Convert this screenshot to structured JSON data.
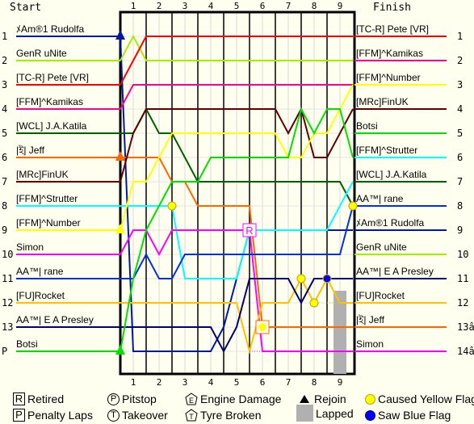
{
  "chart_data": {
    "type": "line",
    "title": "",
    "start_label": "Start",
    "finish_label": "Finish",
    "laps": [
      "1",
      "2",
      "3",
      "4",
      "5",
      "6",
      "7",
      "8",
      "9"
    ],
    "x_axis": "lap (position sampled every half lap, 0 to 9)",
    "y_axis": "race position (1 at top)",
    "start_positions": [
      "1",
      "2",
      "3",
      "4",
      "5",
      "6",
      "7",
      "8",
      "9",
      "10",
      "11",
      "12",
      "13",
      "P"
    ],
    "finish_positions": [
      "1",
      "2",
      "3",
      "4",
      "5",
      "6",
      "7",
      "8",
      "9",
      "10",
      "11",
      "12",
      "13â",
      "14â"
    ],
    "drivers": [
      {
        "name": "ﾒAm®1 Rudolfa",
        "color": "#0018a0",
        "start": 1,
        "finish": 9,
        "positions": [
          1,
          14,
          14,
          14,
          14,
          14,
          14,
          14,
          13,
          11,
          9,
          9,
          9,
          9,
          9,
          9,
          9,
          9,
          9
        ],
        "events": [
          {
            "type": "rejoin",
            "x": 0
          }
        ]
      },
      {
        "name": "GenR uNite",
        "color": "#a0f000",
        "start": 2,
        "finish": 10,
        "positions": [
          2,
          1,
          2,
          2,
          2,
          2,
          2,
          2,
          2,
          2,
          2,
          2,
          2,
          2,
          2,
          2,
          2,
          2,
          2
        ],
        "events": []
      },
      {
        "name": "[TC-R] Pete [VR]",
        "color": "#ff0000",
        "start": 3,
        "finish": 1,
        "positions": [
          3,
          2,
          1,
          1,
          1,
          1,
          1,
          1,
          1,
          1,
          1,
          1,
          1,
          1,
          1,
          1,
          1,
          1,
          1
        ],
        "events": []
      },
      {
        "name": "[FFM]^Kamikas",
        "color": "#ff0090",
        "start": 4,
        "finish": 2,
        "positions": [
          4,
          3,
          3,
          3,
          3,
          3,
          3,
          3,
          3,
          3,
          3,
          3,
          3,
          3,
          3,
          3,
          3,
          3,
          3
        ],
        "events": []
      },
      {
        "name": "[WCL] J.A.Katila",
        "color": "#006000",
        "start": 5,
        "finish": 7,
        "positions": [
          5,
          5,
          4,
          5,
          5,
          6,
          7,
          7,
          7,
          7,
          7,
          7,
          7,
          7,
          7,
          7,
          7,
          7,
          8
        ],
        "events": [
          {
            "type": "yellow",
            "x": 18
          }
        ]
      },
      {
        "name": "|ই| Jeff",
        "color": "#ff6600",
        "start": 6,
        "finish": 13,
        "positions": [
          6,
          6,
          6,
          6,
          7,
          7,
          8,
          8,
          8,
          8,
          8,
          13,
          13,
          13,
          13,
          13,
          13,
          13,
          13
        ],
        "events": [
          {
            "type": "rejoin",
            "x": 0
          },
          {
            "type": "engine",
            "x": 11
          }
        ]
      },
      {
        "name": "[MRc]FinUK",
        "color": "#600000",
        "start": 7,
        "finish": 4,
        "positions": [
          7,
          5,
          4,
          4,
          4,
          4,
          4,
          4,
          4,
          4,
          4,
          4,
          4,
          5,
          4,
          6,
          6,
          5,
          4
        ],
        "events": []
      },
      {
        "name": "[FFM]^Strutter",
        "color": "#00ffff",
        "start": 8,
        "finish": 6,
        "positions": [
          8,
          8,
          8,
          8,
          8,
          11,
          11,
          11,
          11,
          11,
          9,
          9,
          9,
          9,
          9,
          9,
          9,
          8,
          7
        ],
        "events": [
          {
            "type": "yellow",
            "x": 4
          }
        ]
      },
      {
        "name": "[FFM]^Number",
        "color": "#ffff00",
        "start": 9,
        "finish": 3,
        "positions": [
          9,
          7,
          7,
          6,
          5,
          5,
          5,
          5,
          5,
          5,
          5,
          5,
          5,
          6,
          6,
          5,
          5,
          4,
          3
        ],
        "events": [
          {
            "type": "rejoin",
            "x": 0
          }
        ]
      },
      {
        "name": "Simon",
        "color": "#ff00ff",
        "start": 10,
        "finish": 14,
        "positions": [
          10,
          9,
          9,
          10,
          9,
          9,
          9,
          9,
          9,
          9,
          9,
          14,
          14,
          14,
          14,
          14,
          14,
          14,
          14
        ],
        "events": [
          {
            "type": "retired",
            "x": 10
          }
        ]
      },
      {
        "name": "AA™| rane",
        "color": "#0030e0",
        "start": 11,
        "finish": 8,
        "positions": [
          11,
          11,
          10,
          11,
          11,
          10,
          10,
          10,
          10,
          10,
          10,
          10,
          10,
          10,
          10,
          10,
          10,
          10,
          8
        ],
        "events": []
      },
      {
        "name": "[FU]Rocket",
        "color": "#ffc000",
        "start": 12,
        "finish": 12,
        "positions": [
          12,
          12,
          12,
          12,
          12,
          12,
          12,
          12,
          12,
          12,
          14,
          12,
          12,
          12,
          11,
          12,
          11,
          12,
          12
        ],
        "events": [
          {
            "type": "yellow",
            "x": 14
          },
          {
            "type": "yellow",
            "x": 15
          },
          {
            "type": "yellow",
            "x": 16
          },
          {
            "type": "blue",
            "x": 16
          }
        ]
      },
      {
        "name": "AA™| E A Presley",
        "color": "#000070",
        "start": 13,
        "finish": 11,
        "positions": [
          13,
          13,
          13,
          13,
          13,
          13,
          13,
          13,
          14,
          13,
          11,
          11,
          11,
          11,
          12,
          11,
          11,
          11,
          11
        ],
        "events": []
      },
      {
        "name": "Botsi",
        "color": "#00e000",
        "start": 14,
        "finish": 5,
        "positions": [
          14,
          11,
          9,
          8,
          7,
          7,
          7,
          6,
          6,
          6,
          6,
          6,
          6,
          6,
          4,
          5,
          4,
          4,
          6
        ],
        "events": [
          {
            "type": "rejoin",
            "x": 0
          }
        ]
      }
    ],
    "finish_order": [
      "[TC-R] Pete [VR]",
      "[FFM]^Kamikas",
      "[FFM]^Number",
      "[MRc]FinUK",
      "Botsi",
      "[FFM]^Strutter",
      "[WCL] J.A.Katila",
      "AA™| rane",
      "ﾒAm®1 Rudolfa",
      "GenR uNite",
      "AA™| E A Presley",
      "[FU]Rocket",
      "|ই| Jeff",
      "Simon"
    ],
    "lapped": [
      {
        "lap_from": 8.5,
        "lap_to": 9
      }
    ],
    "legend": [
      {
        "icon": "R",
        "label": "Retired"
      },
      {
        "icon": "P-circle",
        "label": "Pitstop"
      },
      {
        "icon": "E-pentagon",
        "label": "Engine Damage"
      },
      {
        "icon": "triangle",
        "label": "Rejoin"
      },
      {
        "icon": "yellow-dot",
        "label": "Caused Yellow Flag"
      },
      {
        "icon": "P",
        "label": "Penalty Laps"
      },
      {
        "icon": "T-circle",
        "label": "Takeover"
      },
      {
        "icon": "T-pentagon",
        "label": "Tyre Broken"
      },
      {
        "icon": "gray-box",
        "label": "Lapped"
      },
      {
        "icon": "blue-dot",
        "label": "Saw Blue Flag"
      }
    ],
    "legend_glyphs": {
      "retired": "R",
      "penalty": "P",
      "pitstop": "P",
      "takeover": "T",
      "engine": "E",
      "tyre": "T"
    }
  }
}
